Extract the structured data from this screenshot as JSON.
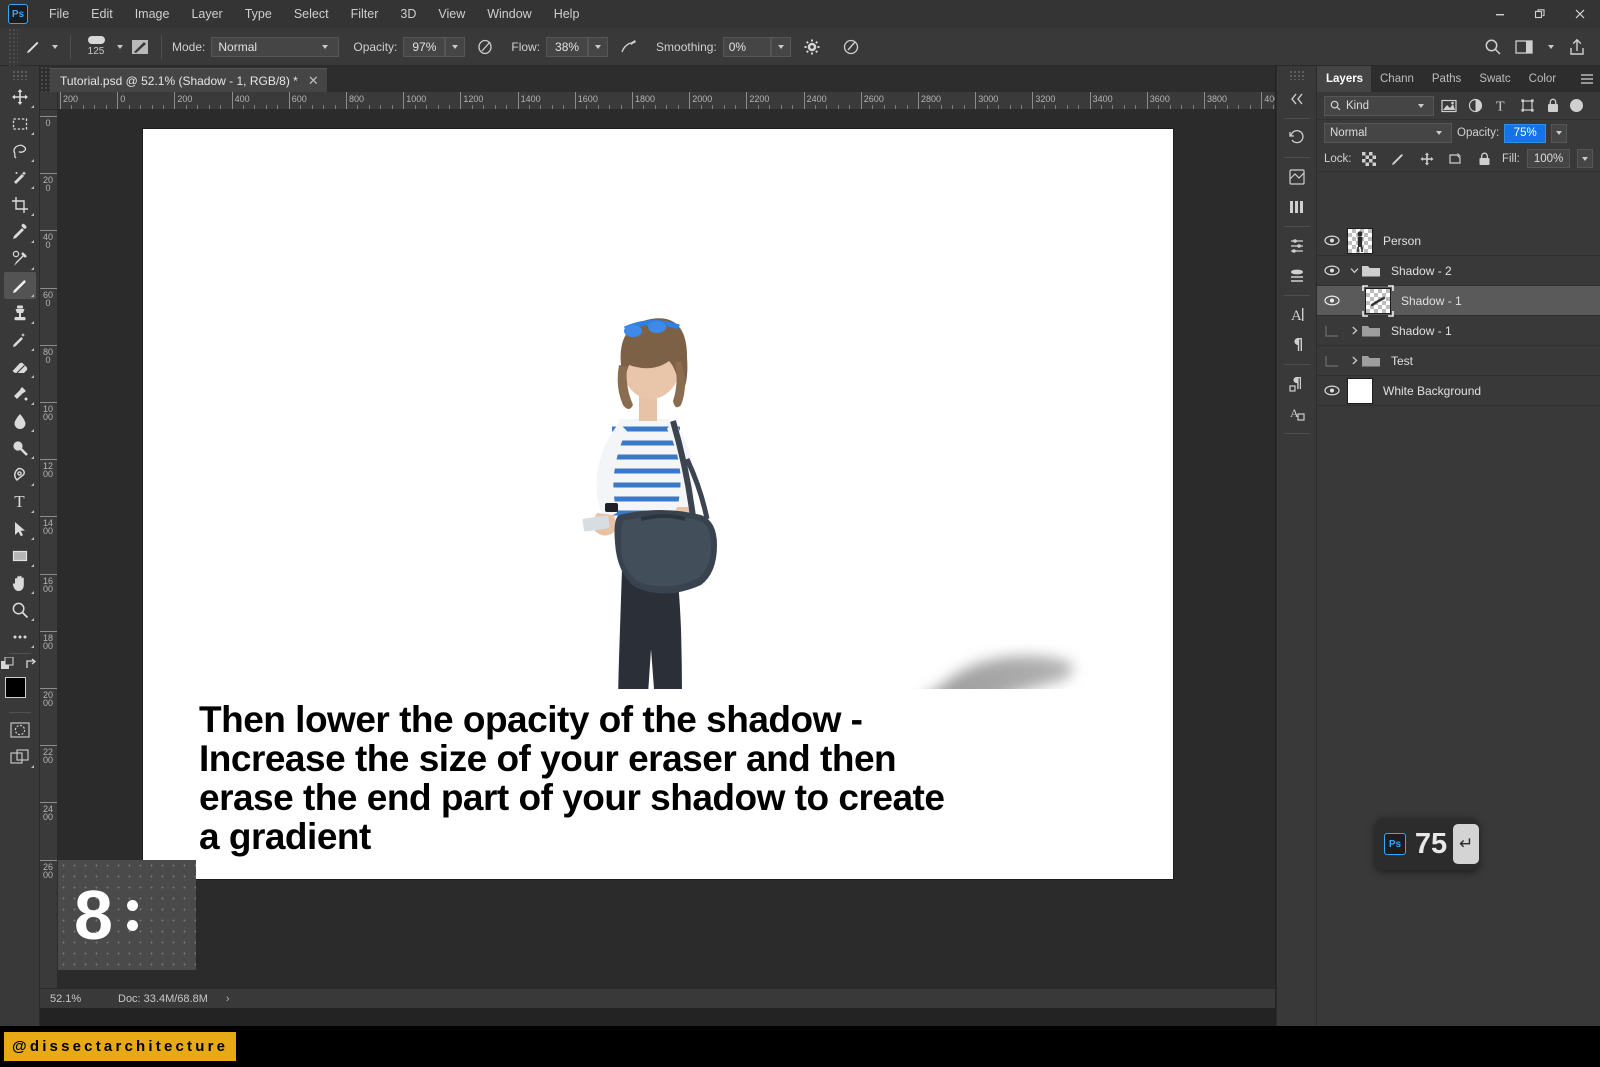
{
  "app": {
    "name": "Adobe Photoshop",
    "logo_text": "Ps"
  },
  "menubar": {
    "items": [
      "File",
      "Edit",
      "Image",
      "Layer",
      "Type",
      "Select",
      "Filter",
      "3D",
      "View",
      "Window",
      "Help"
    ],
    "window_controls": {
      "minimize": "—",
      "restore": "❐",
      "close": "✕"
    }
  },
  "options_bar": {
    "tool": "brush-tool",
    "brush_size": "125",
    "mode_label": "Mode:",
    "mode_value": "Normal",
    "opacity_label": "Opacity:",
    "opacity_value": "97%",
    "flow_label": "Flow:",
    "flow_value": "38%",
    "smoothing_label": "Smoothing:",
    "smoothing_value": "0%"
  },
  "toolbar": {
    "tools": [
      {
        "name": "move-tool",
        "glyph": "✥",
        "active": false
      },
      {
        "name": "rectangular-marquee-tool",
        "glyph": "⬚",
        "active": false
      },
      {
        "name": "lasso-tool",
        "glyph": "⚲",
        "active": false
      },
      {
        "name": "magic-wand-tool",
        "glyph": "✨",
        "active": false
      },
      {
        "name": "crop-tool",
        "glyph": "⛶",
        "active": false
      },
      {
        "name": "eyedropper-tool",
        "glyph": "✒",
        "active": false
      },
      {
        "name": "spot-healing-brush-tool",
        "glyph": "☙",
        "active": false
      },
      {
        "name": "brush-tool",
        "glyph": "✎",
        "active": true
      },
      {
        "name": "clone-stamp-tool",
        "glyph": "⚑",
        "active": false
      },
      {
        "name": "history-brush-tool",
        "glyph": "✐",
        "active": false
      },
      {
        "name": "eraser-tool",
        "glyph": "▰",
        "active": false
      },
      {
        "name": "gradient-tool",
        "glyph": "◢",
        "active": false
      },
      {
        "name": "blur-tool",
        "glyph": "●",
        "active": false
      },
      {
        "name": "dodge-tool",
        "glyph": "◐",
        "active": false
      },
      {
        "name": "pen-tool",
        "glyph": "✑",
        "active": false
      },
      {
        "name": "type-tool",
        "glyph": "T",
        "active": false
      },
      {
        "name": "path-selection-tool",
        "glyph": "➤",
        "active": false
      },
      {
        "name": "rectangle-tool",
        "glyph": "▭",
        "active": false
      },
      {
        "name": "hand-tool",
        "glyph": "✋",
        "active": false
      },
      {
        "name": "zoom-tool",
        "glyph": "⌕",
        "active": false
      },
      {
        "name": "edit-toolbar-tool",
        "glyph": "⋯",
        "active": false
      }
    ],
    "foreground_color": "#000000",
    "background_color": "#ffffff"
  },
  "document": {
    "tab_title": "Tutorial.psd @ 52.1% (Shadow - 1, RGB/8) *",
    "close_glyph": "✕"
  },
  "rulers": {
    "horizontal_labels": [
      "200",
      "0",
      "200",
      "400",
      "600",
      "800",
      "1000",
      "1200",
      "1400",
      "1600",
      "1800",
      "2000",
      "2200",
      "2400",
      "2600",
      "2800",
      "3000",
      "3200",
      "3400",
      "3600",
      "3800",
      "4000"
    ],
    "vertical_labels": [
      "0",
      "200",
      "400",
      "600",
      "800",
      "1000",
      "1200",
      "1400",
      "1600",
      "1800",
      "2000",
      "2200",
      "2400",
      "2600"
    ]
  },
  "canvas_overlay": {
    "lines": [
      "Then lower the opacity of the shadow -",
      "Increase the size of your eraser and then",
      "erase the end part of your shadow to create",
      " a gradient"
    ],
    "step_badge": "8"
  },
  "status_bar": {
    "zoom": "52.1%",
    "doc": "Doc: 33.4M/68.8M",
    "arrow": "›"
  },
  "panel": {
    "tabs": [
      {
        "label": "Layers",
        "active": true
      },
      {
        "label": "Chann",
        "active": false
      },
      {
        "label": "Paths",
        "active": false
      },
      {
        "label": "Swatc",
        "active": false
      },
      {
        "label": "Color",
        "active": false
      }
    ],
    "menu_glyph": "☰",
    "filter": {
      "kind_label": "Kind",
      "search_glyph": "⌕",
      "buttons": [
        "pixel-filter-icon",
        "adjustment-filter-icon",
        "type-filter-icon",
        "shape-filter-icon",
        "smart-object-filter-icon"
      ]
    },
    "blend": {
      "mode": "Normal",
      "opacity_label": "Opacity:",
      "opacity_value": "75%"
    },
    "lock": {
      "label": "Lock:",
      "fill_label": "Fill:",
      "fill_value": "100%",
      "buttons": [
        "lock-transparent-pixels-icon",
        "lock-image-pixels-icon",
        "lock-position-icon",
        "lock-artboard-nesting-icon",
        "lock-all-icon"
      ]
    },
    "layers": [
      {
        "name": "Person",
        "type": "raster",
        "visible": true,
        "selected": false,
        "indent": 0,
        "group": false
      },
      {
        "name": "Shadow - 2",
        "type": "group",
        "visible": true,
        "selected": false,
        "indent": 0,
        "group": true,
        "expanded": true
      },
      {
        "name": "Shadow - 1",
        "type": "raster",
        "visible": true,
        "selected": true,
        "indent": 1,
        "group": false
      },
      {
        "name": "Shadow - 1",
        "type": "group",
        "visible": false,
        "selected": false,
        "indent": 0,
        "group": true,
        "expanded": false
      },
      {
        "name": "Test",
        "type": "group",
        "visible": false,
        "selected": false,
        "indent": 0,
        "group": true,
        "expanded": false
      },
      {
        "name": "White Background",
        "type": "raster",
        "visible": true,
        "selected": false,
        "indent": 0,
        "group": false
      }
    ],
    "footer_buttons": [
      "link-layers-icon",
      "add-layer-style-icon",
      "add-layer-mask-icon",
      "new-adjustment-layer-icon",
      "new-group-icon",
      "new-layer-icon",
      "delete-layer-icon"
    ]
  },
  "hud": {
    "logo": "Ps",
    "value": "75",
    "key_glyph": "↵"
  },
  "watermark": {
    "text": "@dissectarchitecture",
    "background": "#E8AA14"
  }
}
